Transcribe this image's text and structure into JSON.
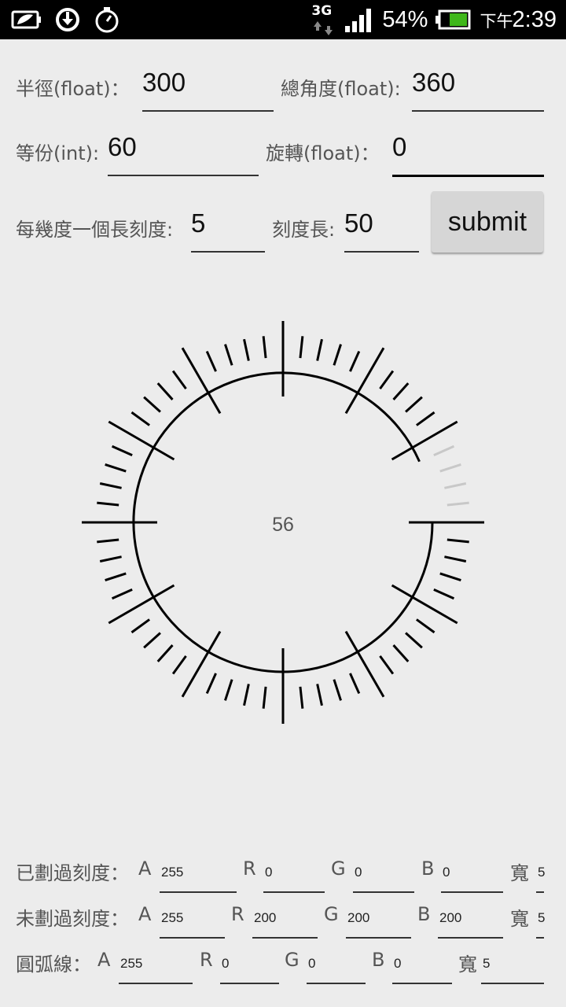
{
  "status_bar": {
    "network": "3G",
    "battery_percent": "54%",
    "time_prefix": "下午",
    "time": "2:39",
    "icons": [
      "battery-saver-icon",
      "sync-icon",
      "stopwatch-icon",
      "network-3g-icon",
      "signal-icon",
      "battery-icon"
    ],
    "battery_color": "#3fb71a"
  },
  "form": {
    "radius_label": "半徑(float)：",
    "radius_value": "300",
    "total_angle_label": "總角度(float):",
    "total_angle_value": "360",
    "divisions_label": "等份(int):",
    "divisions_value": "60",
    "rotation_label": "旋轉(float)：",
    "rotation_value": "0",
    "long_tick_label": "每幾度一個長刻度:",
    "long_tick_value": "5",
    "tick_length_label": "刻度長:",
    "tick_length_value": "50",
    "submit_label": "submit"
  },
  "dial": {
    "center_value": "56",
    "drawn_ticks": 56,
    "total_ticks": 60,
    "long_tick_every": 5,
    "arc_sweep_fraction": 0.9333,
    "colors": {
      "drawn": "#000000",
      "undrawn": "#c8c8c8",
      "arc": "#000000"
    }
  },
  "colors_rows": [
    {
      "label": "已劃過刻度：",
      "a_label": "A",
      "a": "255",
      "r_label": "R",
      "r": "0",
      "g_label": "G",
      "g": "0",
      "b_label": "B",
      "b": "0",
      "w_label": "寬",
      "w": "5"
    },
    {
      "label": "未劃過刻度：",
      "a_label": "A",
      "a": "255",
      "r_label": "R",
      "r": "200",
      "g_label": "G",
      "g": "200",
      "b_label": "B",
      "b": "200",
      "w_label": "寬",
      "w": "5"
    },
    {
      "label": "圓弧線：",
      "a_label": "A",
      "a": "255",
      "r_label": "R",
      "r": "0",
      "g_label": "G",
      "g": "0",
      "b_label": "B",
      "b": "0",
      "w_label": "寬",
      "w": "5"
    }
  ]
}
